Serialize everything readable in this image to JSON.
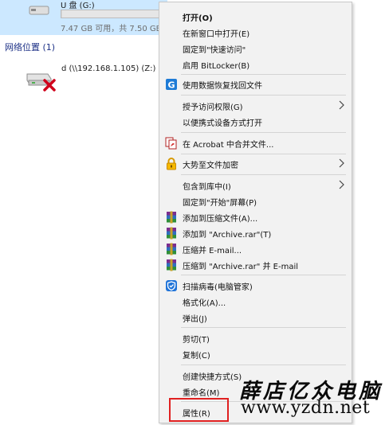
{
  "explorer": {
    "drive": {
      "label": "U 盘 (G:)",
      "space": "7.47 GB 可用，共 7.50 GB",
      "used_fraction": 0.004
    },
    "section_title": "网络位置 (1)",
    "network_drive": {
      "label": "d (\\\\192.168.1.105) (Z:)"
    }
  },
  "menu": {
    "items": [
      {
        "label": "打开(O)"
      },
      {
        "label": "在新窗口中打开(E)"
      },
      {
        "label": "固定到\"快速访问\""
      },
      {
        "label": "启用 BitLocker(B)"
      },
      {
        "label": "使用数据恢复找回文件"
      },
      {
        "label": "授予访问权限(G)"
      },
      {
        "label": "以便携式设备方式打开"
      },
      {
        "label": "在 Acrobat 中合并文件..."
      },
      {
        "label": "大势至文件加密"
      },
      {
        "label": "包含到库中(I)"
      },
      {
        "label": "固定到\"开始\"屏幕(P)"
      },
      {
        "label": "添加到压缩文件(A)..."
      },
      {
        "label": "添加到 \"Archive.rar\"(T)"
      },
      {
        "label": "压缩并 E-mail..."
      },
      {
        "label": "压缩到 \"Archive.rar\" 并 E-mail"
      },
      {
        "label": "扫描病毒(电脑管家)"
      },
      {
        "label": "格式化(A)..."
      },
      {
        "label": "弹出(J)"
      },
      {
        "label": "剪切(T)"
      },
      {
        "label": "复制(C)"
      },
      {
        "label": "创建快捷方式(S)"
      },
      {
        "label": "重命名(M)"
      },
      {
        "label": "属性(R)"
      }
    ]
  },
  "watermark": {
    "name": "薛店亿众电脑",
    "url": "www.yzdn.net"
  },
  "icons": {
    "recover": "data-recovery-icon",
    "acrobat": "acrobat-icon",
    "lock": "lock-icon",
    "winrar": "winrar-icon",
    "shield": "pc-manager-shield-icon"
  },
  "colors": {
    "accent": "#0a78d7",
    "highlight_border": "#e02020",
    "menu_bg": "#f2f2f2",
    "selection_bg": "#cce8ff"
  }
}
